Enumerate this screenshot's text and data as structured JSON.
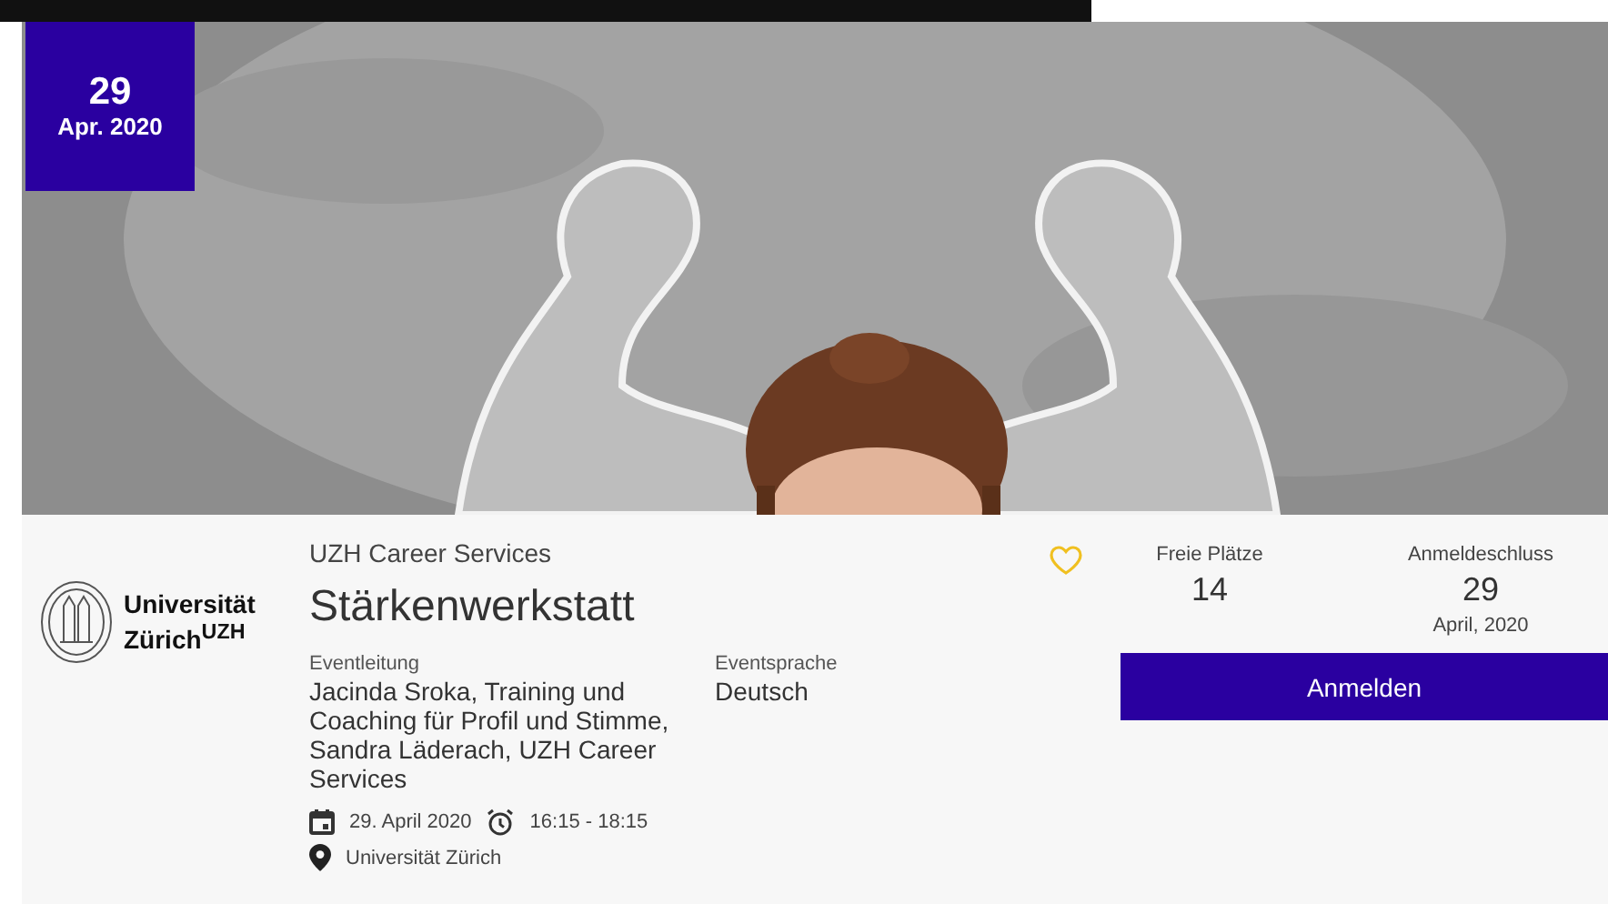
{
  "badge": {
    "day": "29",
    "month_year": "Apr. 2020"
  },
  "logo": {
    "line1": "Universität",
    "line2": "Zürich$^{UZH}$"
  },
  "organizer": "UZH Career Services",
  "title": "Stärkenwerkstatt",
  "favorite": false,
  "fields": [
    {
      "label": "Eventleitung",
      "value": "Jacinda Sroka, Training und Coaching für Profil und Stimme, Sandra Läderach, UZH Career Services"
    },
    {
      "label": "Eventsprache",
      "value": "Deutsch"
    }
  ],
  "date": "29. April 2020",
  "time": "16:15 - 18:15",
  "location": "Universität Zürich",
  "stats": [
    {
      "label": "Freie Plätze",
      "value": "14"
    },
    {
      "label": "Anmeldeschluss",
      "value": "29",
      "note": "April, 2020"
    }
  ],
  "button": "Anmelden"
}
